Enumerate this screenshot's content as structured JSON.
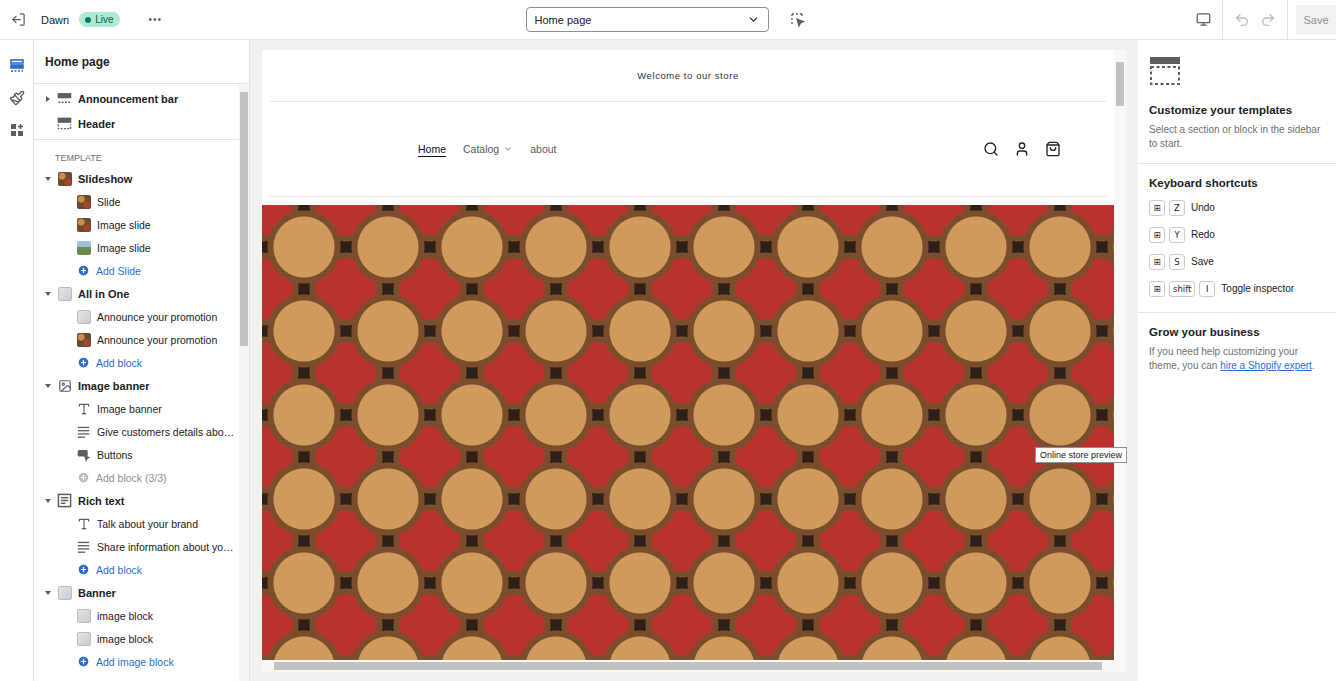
{
  "topbar": {
    "theme": "Dawn",
    "status": "Live",
    "more": "•••",
    "page": "Home page",
    "undo_disabled": true,
    "redo_disabled": true,
    "save": {
      "label": "Save",
      "disabled": true
    }
  },
  "rail": [
    {
      "kind": "sections",
      "selected": true
    },
    {
      "kind": "theme-settings",
      "selected": false
    },
    {
      "kind": "apps",
      "selected": false
    }
  ],
  "sidebar": {
    "title": "Home page",
    "fixed_sections": [
      {
        "label": "Announcement bar",
        "kind": "bar",
        "expandable": true,
        "expanded": false
      },
      {
        "label": "Header",
        "kind": "header",
        "expandable": false,
        "expanded": false
      }
    ],
    "template_label": "TEMPLATE",
    "sections": [
      {
        "label": "Slideshow",
        "kind": "photo",
        "expanded": true,
        "blocks": [
          {
            "label": "Slide",
            "kind": "photo"
          },
          {
            "label": "Image slide",
            "kind": "photo"
          },
          {
            "label": "Image slide",
            "kind": "landscape"
          }
        ],
        "add": {
          "label": "Add Slide",
          "disabled": false
        }
      },
      {
        "label": "All in One",
        "kind": "placeholder",
        "expanded": true,
        "blocks": [
          {
            "label": "Announce your promotion",
            "kind": "placeholder"
          },
          {
            "label": "Announce your promotion",
            "kind": "photo"
          }
        ],
        "add": {
          "label": "Add block",
          "disabled": false
        }
      },
      {
        "label": "Image banner",
        "kind": "image",
        "expanded": true,
        "blocks": [
          {
            "label": "Image banner",
            "kind": "heading"
          },
          {
            "label": "Give customers details abo…",
            "kind": "paragraph"
          },
          {
            "label": "Buttons",
            "kind": "buttons"
          }
        ],
        "add": {
          "label": "Add block (3/3)",
          "disabled": true
        }
      },
      {
        "label": "Rich text",
        "kind": "richtext",
        "expanded": true,
        "blocks": [
          {
            "label": "Talk about your brand",
            "kind": "heading"
          },
          {
            "label": "Share information about yo…",
            "kind": "paragraph"
          }
        ],
        "add": {
          "label": "Add block",
          "disabled": false
        }
      },
      {
        "label": "Banner",
        "kind": "placeholder",
        "expanded": true,
        "blocks": [
          {
            "label": "image block",
            "kind": "placeholder"
          },
          {
            "label": "image block",
            "kind": "placeholder"
          }
        ],
        "add": {
          "label": "Add image block",
          "disabled": false
        }
      }
    ]
  },
  "preview": {
    "announcement": "Welcome to our store",
    "nav": [
      {
        "label": "Home",
        "selected": true,
        "dropdown": false
      },
      {
        "label": "Catalog",
        "selected": false,
        "dropdown": true
      },
      {
        "label": "about",
        "selected": false,
        "dropdown": false
      }
    ],
    "tooltip": "Online store preview"
  },
  "inspector": {
    "title": "Customize your templates",
    "text": "Select a section or block in the sidebar to start.",
    "shortcuts_title": "Keyboard shortcuts",
    "shortcuts": [
      {
        "keys": [
          "⊞",
          "Z"
        ],
        "label": "Undo"
      },
      {
        "keys": [
          "⊞",
          "Y"
        ],
        "label": "Redo"
      },
      {
        "keys": [
          "⊞",
          "S"
        ],
        "label": "Save"
      },
      {
        "keys": [
          "⊞",
          "shift",
          "I"
        ],
        "label": "Toggle inspector"
      }
    ],
    "grow_title": "Grow your business",
    "grow_text": "If you need help customizing your theme, you can ",
    "grow_link": "hire a Shopify expert",
    "grow_end": "."
  }
}
